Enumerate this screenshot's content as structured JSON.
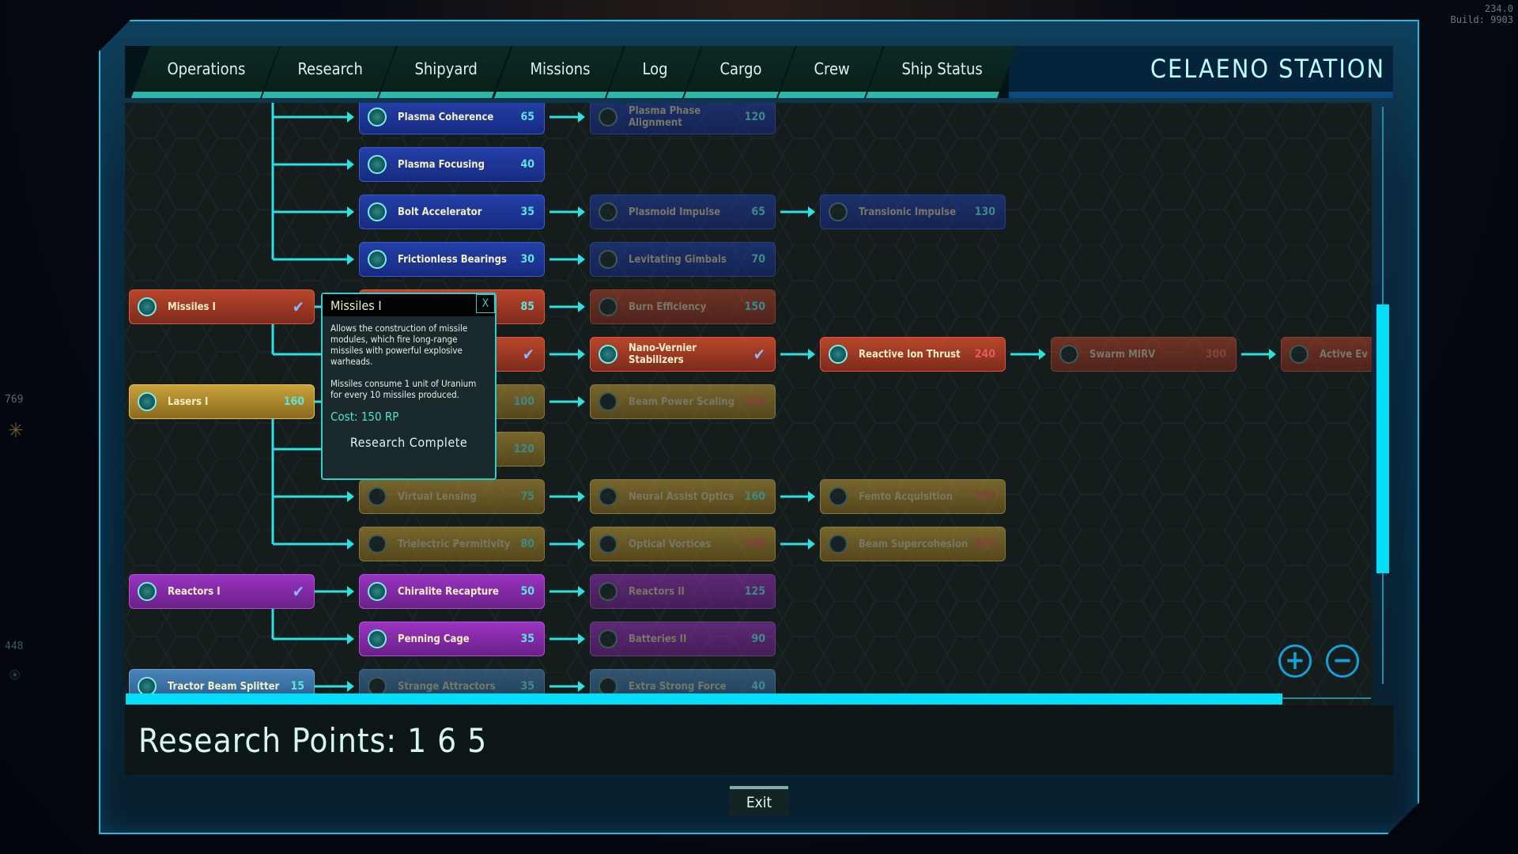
{
  "hud": {
    "version": "234.0",
    "build": "Build: 9903",
    "left_stat_1": "769",
    "left_stat_2": "448"
  },
  "nav": {
    "tabs": [
      "Operations",
      "Research",
      "Shipyard",
      "Missions",
      "Log",
      "Cargo",
      "Crew",
      "Ship Status"
    ],
    "station_title": "CELAENO STATION"
  },
  "colors": {
    "accent": "#00def8",
    "blue": "#2440a8",
    "red": "#b8462c",
    "gold": "#c8a23a",
    "purple": "#9a34c0",
    "steel": "#4a84b8"
  },
  "tree": {
    "rows": [
      {
        "branch": "blue",
        "cells": [
          null,
          {
            "name": "Plasma Coherence",
            "cost": "65"
          },
          {
            "name": "Plasma Phase Alignment",
            "cost": "120",
            "locked": true
          }
        ]
      },
      {
        "branch": "blue",
        "cells": [
          null,
          {
            "name": "Plasma Focusing",
            "cost": "40"
          }
        ]
      },
      {
        "branch": "blue",
        "cells": [
          null,
          {
            "name": "Bolt Accelerator",
            "cost": "35"
          },
          {
            "name": "Plasmoid Impulse",
            "cost": "65",
            "locked": true
          },
          {
            "name": "Transionic Impulse",
            "cost": "130",
            "locked": true
          }
        ]
      },
      {
        "branch": "blue",
        "cells": [
          null,
          {
            "name": "Frictionless Bearings",
            "cost": "30"
          },
          {
            "name": "Levitating Gimbals",
            "cost": "70",
            "locked": true
          }
        ]
      },
      {
        "branch": "red",
        "cells": [
          {
            "name": "Missiles I",
            "researched": true
          },
          {
            "name": "",
            "cost": "85"
          },
          {
            "name": "Burn Efficiency",
            "cost": "150",
            "locked": true
          }
        ]
      },
      {
        "branch": "red",
        "cells": [
          null,
          {
            "name": "",
            "researched": true
          },
          {
            "name": "Nano-Vernier Stabilizers",
            "researched": true
          },
          {
            "name": "Reactive Ion Thrust",
            "cost": "240",
            "expensive": true
          },
          {
            "name": "Swarm MIRV",
            "cost": "300",
            "locked": true,
            "expensive": true
          },
          {
            "name": "Active Ev",
            "locked": true
          }
        ]
      },
      {
        "branch": "gold",
        "cells": [
          {
            "name": "Lasers I",
            "cost": "160"
          },
          {
            "name": "",
            "cost": "100",
            "locked": true
          },
          {
            "name": "Beam Power Scaling",
            "cost": "220",
            "locked": true,
            "expensive": true
          }
        ]
      },
      {
        "branch": "gold",
        "cells": [
          null,
          {
            "name": "",
            "cost": "120",
            "locked": true
          }
        ]
      },
      {
        "branch": "gold",
        "cells": [
          null,
          {
            "name": "Virtual Lensing",
            "cost": "75",
            "locked": true
          },
          {
            "name": "Neural Assist Optics",
            "cost": "160",
            "locked": true
          },
          {
            "name": "Femto Acquisition",
            "cost": "200",
            "locked": true,
            "expensive": true
          }
        ]
      },
      {
        "branch": "gold",
        "cells": [
          null,
          {
            "name": "Trielectric Permitivity",
            "cost": "80",
            "locked": true
          },
          {
            "name": "Optical Vortices",
            "cost": "200",
            "locked": true,
            "expensive": true
          },
          {
            "name": "Beam Supercohesion",
            "cost": "350",
            "locked": true,
            "expensive": true
          }
        ]
      },
      {
        "branch": "purple",
        "cells": [
          {
            "name": "Reactors I",
            "researched": true
          },
          {
            "name": "Chiralite Recapture",
            "cost": "50"
          },
          {
            "name": "Reactors II",
            "cost": "125",
            "locked": true
          }
        ]
      },
      {
        "branch": "purple",
        "cells": [
          null,
          {
            "name": "Penning Cage",
            "cost": "35"
          },
          {
            "name": "Batteries II",
            "cost": "90",
            "locked": true
          }
        ]
      },
      {
        "branch": "steel",
        "cells": [
          {
            "name": "Tractor Beam Splitter",
            "cost": "15"
          },
          {
            "name": "Strange Attractors",
            "cost": "35",
            "locked": true
          },
          {
            "name": "Extra Strong Force",
            "cost": "40",
            "locked": true
          }
        ]
      }
    ]
  },
  "tooltip": {
    "title": "Missiles I",
    "close": "X",
    "description": "Allows the construction of missile modules, which fire long-range missiles with powerful explosive warheads.\n\nMissiles consume 1 unit of Uranium for every 10 missiles produced.",
    "cost": "Cost: 150 RP",
    "status": "Research Complete"
  },
  "zoom": {
    "in": "+",
    "out": "−"
  },
  "footer": {
    "research_points": "Research Points:  1 6 5",
    "exit": "Exit"
  }
}
